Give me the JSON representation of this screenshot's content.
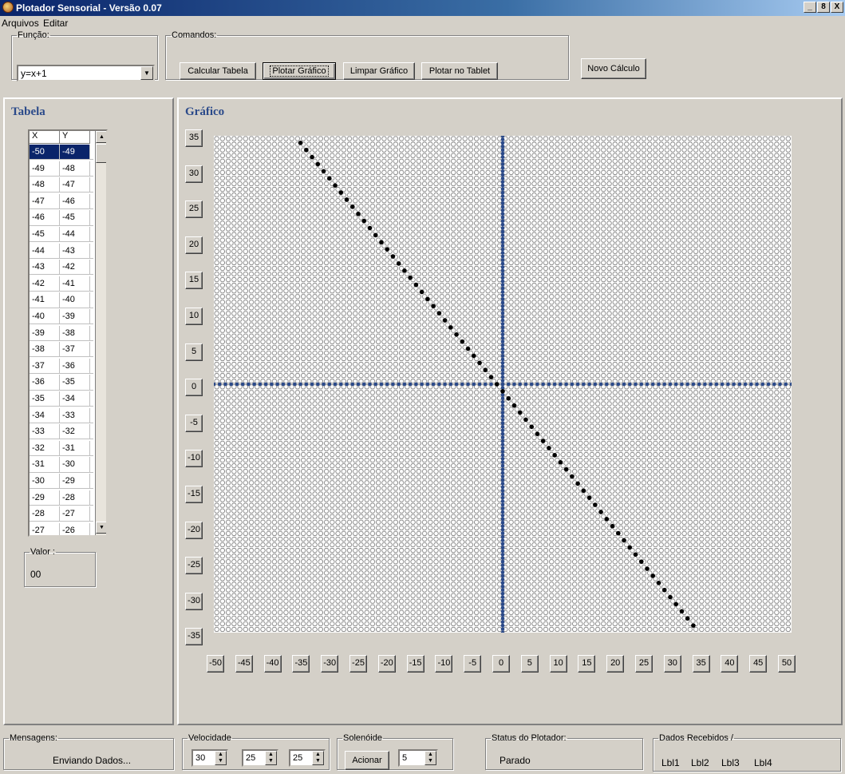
{
  "window": {
    "title": "Plotador Sensorial - Versão 0.07",
    "buttons": [
      "_",
      "8",
      "X"
    ]
  },
  "menu": [
    "Arquivos",
    "Editar"
  ],
  "funcao": {
    "label": "Função:",
    "value": "y=x+1"
  },
  "comandos": {
    "label": "Comandos:",
    "buttons": [
      "Calcular Tabela",
      "Plotar Gráfico",
      "Limpar Gráfico",
      "Plotar no Tablet"
    ]
  },
  "novo_calculo": "Novo Cálculo",
  "tabela": {
    "title": "Tabela",
    "headers": [
      "X",
      "Y"
    ],
    "rows": [
      [
        "-50",
        "-49"
      ],
      [
        "-49",
        "-48"
      ],
      [
        "-48",
        "-47"
      ],
      [
        "-47",
        "-46"
      ],
      [
        "-46",
        "-45"
      ],
      [
        "-45",
        "-44"
      ],
      [
        "-44",
        "-43"
      ],
      [
        "-43",
        "-42"
      ],
      [
        "-42",
        "-41"
      ],
      [
        "-41",
        "-40"
      ],
      [
        "-40",
        "-39"
      ],
      [
        "-39",
        "-38"
      ],
      [
        "-38",
        "-37"
      ],
      [
        "-37",
        "-36"
      ],
      [
        "-36",
        "-35"
      ],
      [
        "-35",
        "-34"
      ],
      [
        "-34",
        "-33"
      ],
      [
        "-33",
        "-32"
      ],
      [
        "-32",
        "-31"
      ],
      [
        "-31",
        "-30"
      ],
      [
        "-30",
        "-29"
      ],
      [
        "-29",
        "-28"
      ],
      [
        "-28",
        "-27"
      ],
      [
        "-27",
        "-26"
      ]
    ],
    "valor_label": "Valor :",
    "valor": "00"
  },
  "grafico": {
    "title": "Gráfico",
    "y_labels": [
      "35",
      "30",
      "25",
      "20",
      "15",
      "10",
      "5",
      "0",
      "-5",
      "-10",
      "-15",
      "-20",
      "-25",
      "-30",
      "-35"
    ],
    "x_labels": [
      "-50",
      "-45",
      "-40",
      "-35",
      "-30",
      "-25",
      "-20",
      "-15",
      "-10",
      "-5",
      "0",
      "5",
      "10",
      "15",
      "20",
      "25",
      "30",
      "35",
      "40",
      "45",
      "50"
    ]
  },
  "chart_data": {
    "type": "scatter",
    "xlim": [
      -50,
      50
    ],
    "ylim": [
      -35,
      35
    ],
    "grid": true,
    "axis_color": "#2b4a8a",
    "point_color": "#000000",
    "series": [
      {
        "x_range": [
          -35,
          33
        ],
        "y_range": [
          34,
          -34
        ]
      }
    ]
  },
  "status": {
    "mensagens_label": "Mensagens:",
    "mensagens": "Enviando Dados...",
    "velocidade_label": "Velocidade",
    "velocidade": "30",
    "spin2": "25",
    "spin3": "25",
    "solenoide_label": "Solenóide",
    "acionar": "Acionar",
    "solenoide_value": "5",
    "status_label": "Status do Plotador:",
    "status": "Parado",
    "dados_label": "Dados Recebidos /",
    "lbls": [
      "Lbl1",
      "Lbl2",
      "Lbl3",
      "Lbl4"
    ]
  }
}
